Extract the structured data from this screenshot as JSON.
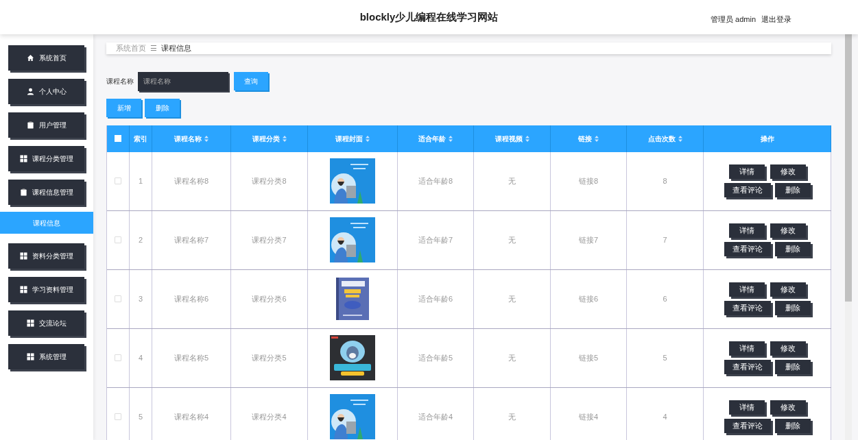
{
  "header": {
    "title": "blockly少儿编程在线学习网站",
    "user": "管理员 admin",
    "logout": "退出登录"
  },
  "sidebar": {
    "items": [
      {
        "label": "系统首页",
        "selected": false
      },
      {
        "label": "个人中心",
        "selected": false
      },
      {
        "label": "用户管理",
        "selected": false
      },
      {
        "label": "课程分类管理",
        "selected": false
      },
      {
        "label": "课程信息管理",
        "selected": false,
        "children": [
          {
            "label": "课程信息",
            "selected": true
          }
        ]
      },
      {
        "label": "资料分类管理",
        "selected": false
      },
      {
        "label": "学习资料管理",
        "selected": false
      },
      {
        "label": "交流论坛",
        "selected": false
      },
      {
        "label": "系统管理",
        "selected": false
      }
    ]
  },
  "breadcrumb": {
    "home": "系统首页",
    "separator": "☰",
    "current": "课程信息"
  },
  "search": {
    "label": "课程名称",
    "placeholder": "课程名称",
    "button": "查询"
  },
  "actions": [
    "新增",
    "删除"
  ],
  "table": {
    "select_all": {
      "checked": false
    },
    "columns": [
      {
        "label": "索引",
        "sortable": false
      },
      {
        "label": "课程名称",
        "sortable": true
      },
      {
        "label": "课程分类",
        "sortable": true
      },
      {
        "label": "课程封面",
        "sortable": true
      },
      {
        "label": "适合年龄",
        "sortable": true
      },
      {
        "label": "课程视频",
        "sortable": true
      },
      {
        "label": "链接",
        "sortable": true
      },
      {
        "label": "点击次数",
        "sortable": true
      },
      {
        "label": "操作",
        "sortable": false
      }
    ],
    "rows": [
      {
        "checked": false,
        "index": "1",
        "name": "课程名称8",
        "category": "课程分类8",
        "cover": {
          "kind": "picture"
        },
        "age": "适合年龄8",
        "video": "无",
        "link": "链接8",
        "clicks": "8",
        "buttons": [
          "详情",
          "修改",
          "查看评论",
          "删除"
        ]
      },
      {
        "checked": false,
        "index": "2",
        "name": "课程名称7",
        "category": "课程分类7",
        "cover": {
          "kind": "picture"
        },
        "age": "适合年龄7",
        "video": "无",
        "link": "链接7",
        "clicks": "7",
        "buttons": [
          "详情",
          "修改",
          "查看评论",
          "删除"
        ]
      },
      {
        "checked": false,
        "index": "3",
        "name": "课程名称6",
        "category": "课程分类6",
        "cover": {
          "kind": "picture"
        },
        "age": "适合年龄6",
        "video": "无",
        "link": "链接6",
        "clicks": "6",
        "buttons": [
          "详情",
          "修改",
          "查看评论",
          "删除"
        ]
      },
      {
        "checked": false,
        "index": "4",
        "name": "课程名称5",
        "category": "课程分类5",
        "cover": {
          "kind": "picture"
        },
        "age": "适合年龄5",
        "video": "无",
        "link": "链接5",
        "clicks": "5",
        "buttons": [
          "详情",
          "修改",
          "查看评论",
          "删除"
        ]
      },
      {
        "checked": false,
        "index": "5",
        "name": "课程名称4",
        "category": "课程分类4",
        "cover": {
          "kind": "picture"
        },
        "age": "适合年龄4",
        "video": "无",
        "link": "链接4",
        "clicks": "4",
        "buttons": [
          "详情",
          "修改",
          "查看评论",
          "删除"
        ]
      }
    ]
  }
}
